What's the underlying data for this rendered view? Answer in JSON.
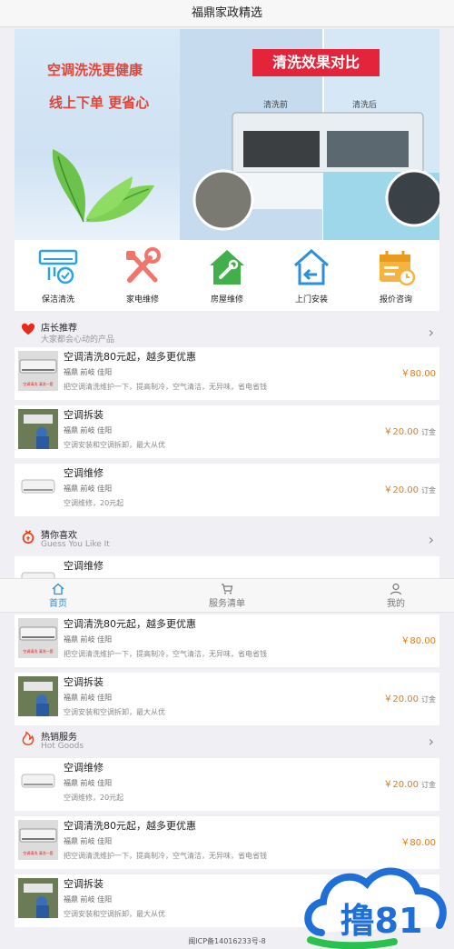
{
  "app": {
    "title": "福鼎家政精选"
  },
  "banner": {
    "slogan_line1": "空调洗洗更健康",
    "slogan_line2": "线上下单 更省心",
    "badge": "清洗效果对比",
    "before_label": "清洗前",
    "after_label": "清洗后"
  },
  "categories": [
    {
      "label": "保洁清洗",
      "icon": "ac-cleaning-icon"
    },
    {
      "label": "家电维修",
      "icon": "tools-icon"
    },
    {
      "label": "房屋维修",
      "icon": "house-repair-icon"
    },
    {
      "label": "上门安装",
      "icon": "home-install-icon"
    },
    {
      "label": "报价咨询",
      "icon": "calendar-clock-icon"
    }
  ],
  "sections": {
    "recommend": {
      "title": "店长推荐",
      "subtitle": "大家都会心动的产品",
      "icon": "heart-icon"
    },
    "guess": {
      "title": "猜你喜欢",
      "subtitle": "Guess You Like It",
      "icon": "gift-icon"
    },
    "hot": {
      "title": "热销服务",
      "subtitle": "Hot Goods",
      "icon": "fire-icon"
    }
  },
  "products": {
    "clean": {
      "name": "空调清洗80元起，越多更优惠",
      "location": "福鼎 前岐 佳阳",
      "desc": "把空调清洗维护一下，提高制冷，空气清洁，无异味，省电省钱",
      "price": "￥80.00",
      "unit": ""
    },
    "install": {
      "name": "空调拆装",
      "location": "福鼎 前岐 佳阳",
      "desc": "空调安装和空调拆卸，最大从优",
      "price": "￥20.00",
      "unit": "订金"
    },
    "repair": {
      "name": "空调维修",
      "location": "福鼎 前岐 佳阳",
      "desc": "空调维修，20元起",
      "price": "￥20.00",
      "unit": "订金"
    }
  },
  "thumb_caption": "空调清洗 清洗一套",
  "tabbar": [
    {
      "label": "首页",
      "icon": "home-icon",
      "active": true
    },
    {
      "label": "服务清单",
      "icon": "cart-icon",
      "active": false
    },
    {
      "label": "我的",
      "icon": "user-icon",
      "active": false
    }
  ],
  "footer": {
    "icp": "闽ICP备14016233号-8"
  },
  "watermark": {
    "text": "撸81"
  },
  "colors": {
    "accent": "#1e90e8",
    "price": "#e57b12",
    "brand_red": "#e4243a"
  }
}
